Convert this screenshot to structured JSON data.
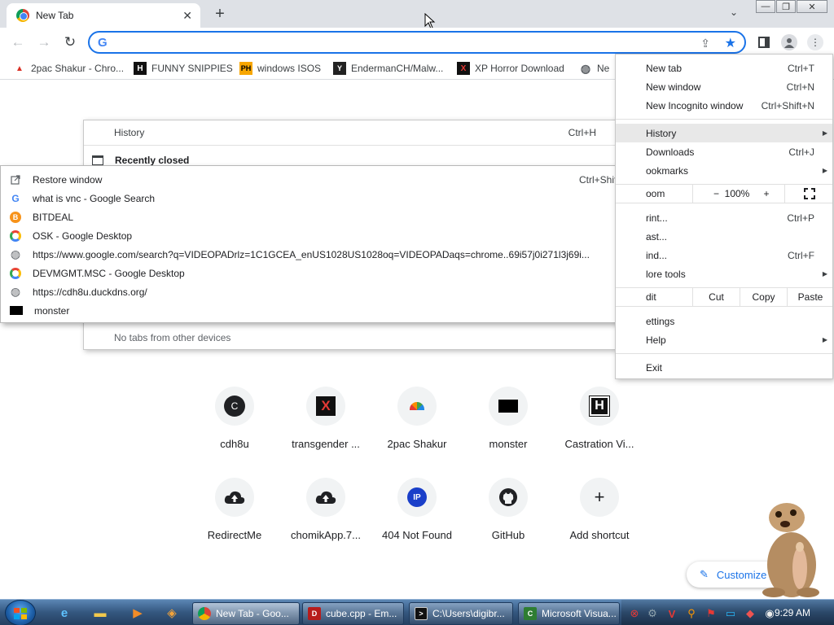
{
  "tab": {
    "title": "New Tab",
    "close": "✕"
  },
  "newtab": "+",
  "tabsearch": "⌄",
  "window": {
    "minimize": "—",
    "restore": "❐",
    "close": "✕"
  },
  "toolbar": {
    "omnibox": {
      "g": "G",
      "value": "",
      "placeholder": ""
    }
  },
  "bookmarks": [
    {
      "label": "2pac Shakur - Chro..."
    },
    {
      "label": "FUNNY SNIPPIES"
    },
    {
      "label": "windows ISOS"
    },
    {
      "label": "EndermanCH/Malw..."
    },
    {
      "label": "XP Horror Download"
    },
    {
      "label": "Ne"
    }
  ],
  "shortcuts": [
    {
      "label": "cdh8u",
      "glyph": "C"
    },
    {
      "label": "transgender ...",
      "glyph": "X"
    },
    {
      "label": "2pac Shakur",
      "glyph": ""
    },
    {
      "label": "monster",
      "glyph": ""
    },
    {
      "label": "Castration Vi...",
      "glyph": "H"
    },
    {
      "label": "RedirectMe",
      "glyph": ""
    },
    {
      "label": "chomikApp.7...",
      "glyph": ""
    },
    {
      "label": "404 Not Found",
      "glyph": "IP"
    },
    {
      "label": "GitHub",
      "glyph": ""
    },
    {
      "label": "Add shortcut",
      "glyph": "+"
    }
  ],
  "customize": "Customize",
  "history_panel": {
    "history_label": "History",
    "history_shortcut": "Ctrl+H",
    "recently_closed": "Recently closed",
    "no_tabs": "No tabs from other devices"
  },
  "recent": {
    "restore": "Restore window",
    "restore_shortcut": "Ctrl+Shift+T",
    "items": [
      {
        "label": "what is vnc - Google Search"
      },
      {
        "label": "BITDEAL"
      },
      {
        "label": "OSK - Google Desktop"
      },
      {
        "label": "https://www.google.com/search?q=VIDEOPADrlz=1C1GCEA_enUS1028US1028oq=VIDEOPADaqs=chrome..69i57j0i271l3j69i..."
      },
      {
        "label": "DEVMGMT.MSC - Google Desktop"
      },
      {
        "label": "https://cdh8u.duckdns.org/"
      },
      {
        "label": "monster"
      }
    ]
  },
  "menu": {
    "new_tab": "New tab",
    "new_tab_sc": "Ctrl+T",
    "new_window": "New window",
    "new_window_sc": "Ctrl+N",
    "incognito": "New Incognito window",
    "incognito_sc": "Ctrl+Shift+N",
    "history": "History",
    "downloads": "Downloads",
    "downloads_sc": "Ctrl+J",
    "bookmarks": "ookmarks",
    "zoom": "oom",
    "zoom_minus": "−",
    "zoom_value": "100%",
    "zoom_plus": "+",
    "print": "rint...",
    "print_sc": "Ctrl+P",
    "cast": "ast...",
    "find": "ind...",
    "find_sc": "Ctrl+F",
    "more_tools": "lore tools",
    "edit": "dit",
    "cut": "Cut",
    "copy": "Copy",
    "paste": "Paste",
    "settings": "ettings",
    "help": "Help",
    "exit": "Exit"
  },
  "taskbar": {
    "buttons": [
      {
        "label": "New Tab - Goo..."
      },
      {
        "label": "cube.cpp - Em..."
      },
      {
        "label": "C:\\Users\\digibr..."
      },
      {
        "label": "Microsoft Visua..."
      }
    ],
    "clock": "9:29 AM"
  }
}
